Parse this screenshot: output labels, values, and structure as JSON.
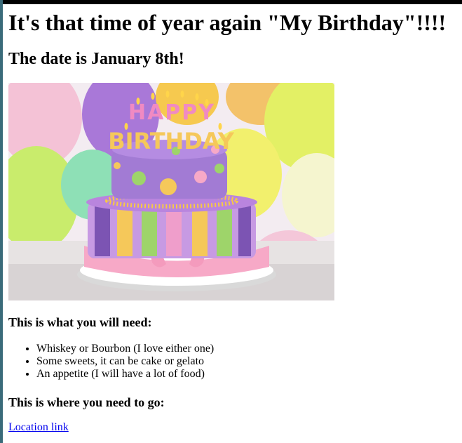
{
  "page": {
    "title": "It's that time of year again \"My Birthday\"!!!!",
    "subtitle": "The date is January 8th!",
    "image": {
      "alt": "Birthday cake with HAPPY BIRTHDAY candles in front of balloons",
      "candle_text_top": "HAPPY",
      "candle_text_bottom": "BIRTHDAY"
    },
    "need_heading": "This is what you will need:",
    "need_items": [
      "Whiskey or Bourbon (I love either one)",
      "Some sweets, it can be cake or gelato",
      "An appetite (I will have a lot of food)"
    ],
    "go_heading": "This is where you need to go:",
    "location_link": "Location link"
  },
  "colors": {
    "link": "#0000ee",
    "frame_top": "#000000",
    "frame_left": "#3a6b7a"
  }
}
